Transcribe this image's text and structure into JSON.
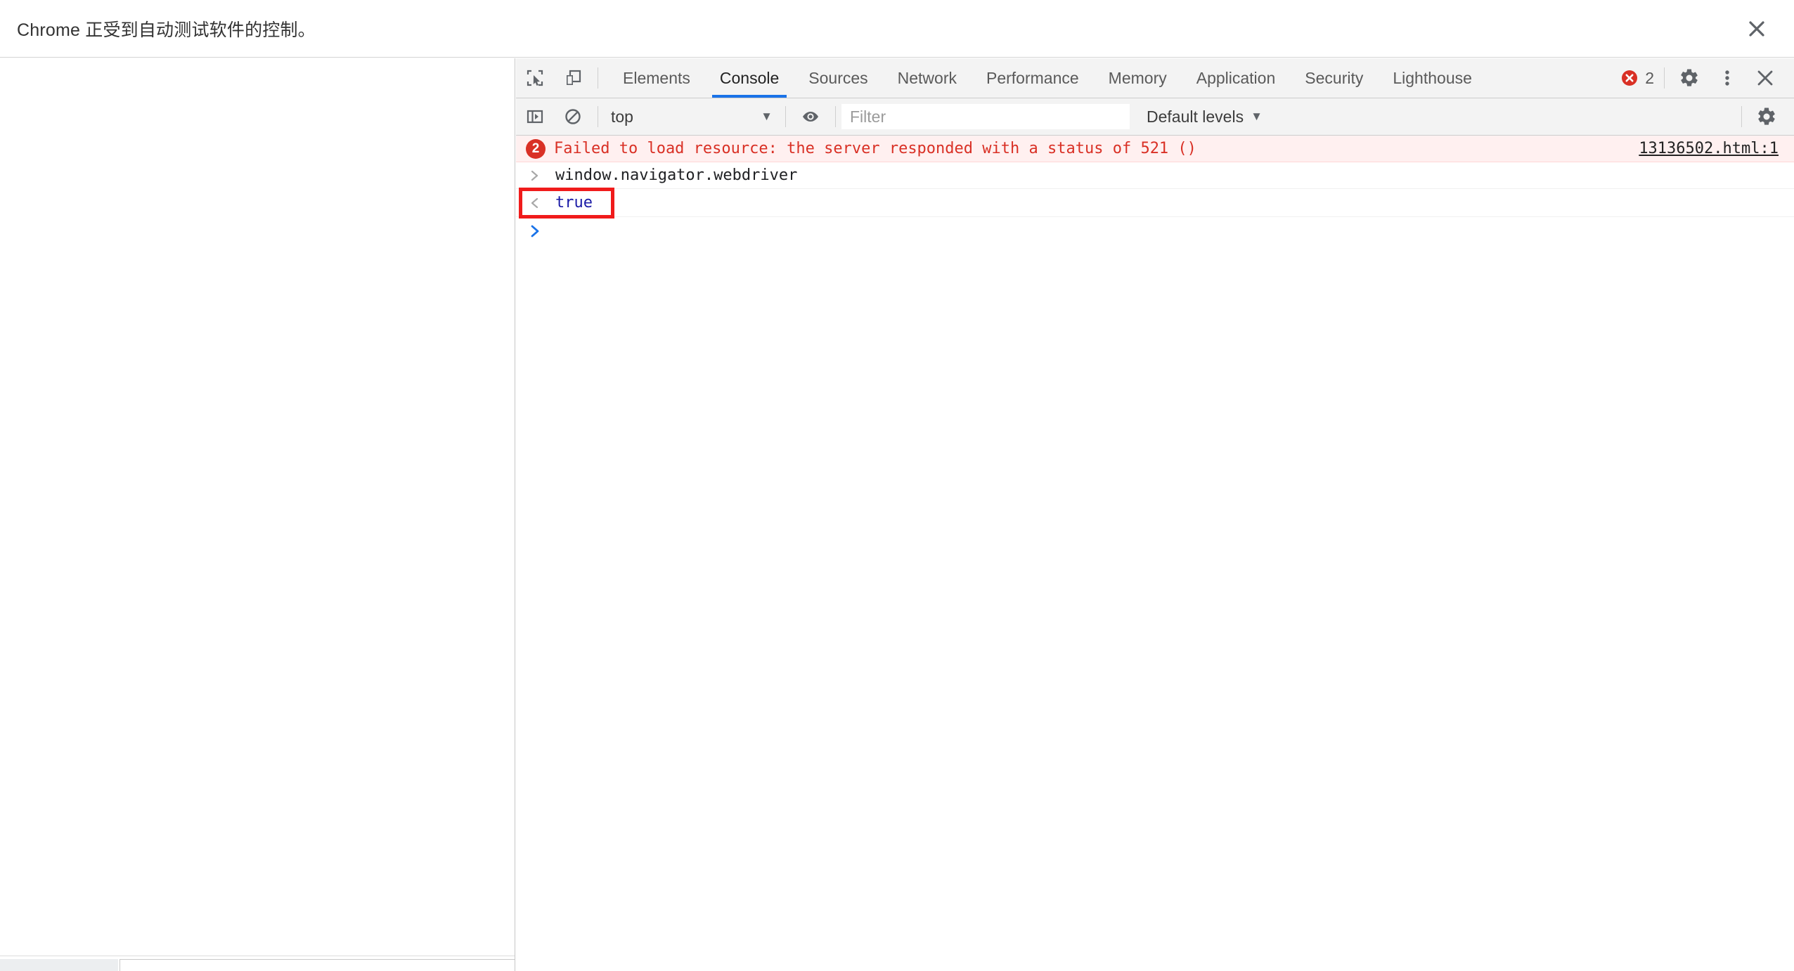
{
  "infobar": {
    "message": "Chrome 正受到自动测试软件的控制。",
    "close_label": "×"
  },
  "devtools": {
    "toolbar": {
      "inspect_icon": "inspect-element-icon",
      "device_toolbar_icon": "device-toolbar-icon",
      "tabs": [
        {
          "label": "Elements",
          "active": false
        },
        {
          "label": "Console",
          "active": true
        },
        {
          "label": "Sources",
          "active": false
        },
        {
          "label": "Network",
          "active": false
        },
        {
          "label": "Performance",
          "active": false
        },
        {
          "label": "Memory",
          "active": false
        },
        {
          "label": "Application",
          "active": false
        },
        {
          "label": "Security",
          "active": false
        },
        {
          "label": "Lighthouse",
          "active": false
        }
      ],
      "error_count": "2",
      "settings_icon": "gear-icon",
      "more_icon": "kebab-menu-icon",
      "close_icon": "close-icon"
    },
    "console_toolbar": {
      "sidebar_toggle_icon": "console-sidebar-toggle-icon",
      "clear_icon": "clear-console-icon",
      "context": "top",
      "context_arrow": "▼",
      "eye_icon": "live-expression-eye-icon",
      "filter_placeholder": "Filter",
      "filter_value": "",
      "levels": "Default levels",
      "levels_arrow": "▼",
      "settings_icon": "console-settings-gear-icon"
    },
    "messages": [
      {
        "type": "error",
        "count": "2",
        "text": "Failed to load resource: the server responded with a status of 521 ()",
        "source": "13136502.html:1"
      },
      {
        "type": "input",
        "chevron": "❯",
        "text": "window.navigator.webdriver"
      },
      {
        "type": "result",
        "chevron": "‹·",
        "text": "true"
      }
    ],
    "prompt": {
      "chevron": "❯",
      "value": ""
    }
  },
  "annotation": {
    "color": "#f01b1b",
    "target": "true"
  }
}
